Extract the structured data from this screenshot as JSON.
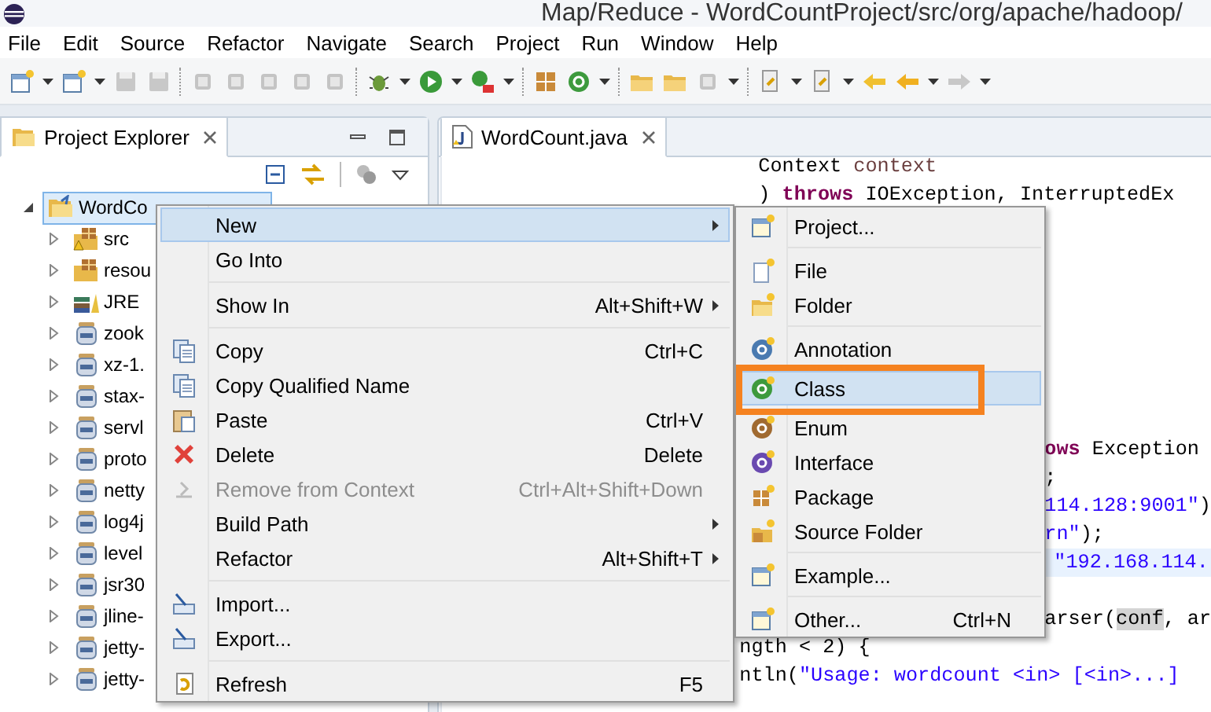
{
  "window": {
    "title": "Map/Reduce - WordCountProject/src/org/apache/hadoop/"
  },
  "menu_bar": [
    "File",
    "Edit",
    "Source",
    "Refactor",
    "Navigate",
    "Search",
    "Project",
    "Run",
    "Window",
    "Help"
  ],
  "project_explorer": {
    "tab": {
      "label": "Project Explorer",
      "selected": true
    },
    "tree": [
      {
        "label": "WordCo",
        "expanded": true,
        "selected": true,
        "children": [
          {
            "label": "src",
            "expanded": false,
            "selected": false
          },
          {
            "label": "resou",
            "expanded": false,
            "selected": false
          },
          {
            "label": "JRE",
            "expanded": false,
            "selected": false
          },
          {
            "label": "zook",
            "expanded": false,
            "selected": false
          },
          {
            "label": "xz-1.",
            "expanded": false,
            "selected": false
          },
          {
            "label": "stax-",
            "expanded": false,
            "selected": false
          },
          {
            "label": "servl",
            "expanded": false,
            "selected": false
          },
          {
            "label": "proto",
            "expanded": false,
            "selected": false
          },
          {
            "label": "netty",
            "expanded": false,
            "selected": false
          },
          {
            "label": "log4j",
            "expanded": false,
            "selected": false
          },
          {
            "label": "level",
            "expanded": false,
            "selected": false
          },
          {
            "label": "jsr30",
            "expanded": false,
            "selected": false
          },
          {
            "label": "jline-",
            "expanded": false,
            "selected": false
          },
          {
            "label": "jetty-",
            "expanded": false,
            "selected": false
          },
          {
            "label": "jetty-",
            "expanded": false,
            "selected": false
          }
        ]
      }
    ]
  },
  "editor": {
    "tab": {
      "label": "WordCount.java",
      "selected": true
    },
    "lines": [
      {
        "current": false,
        "tokens": [
          {
            "text": "Context ",
            "kind": "plain"
          },
          {
            "text": "context",
            "kind": "variable"
          }
        ]
      },
      {
        "current": false,
        "tokens": [
          {
            "text": ") ",
            "kind": "plain"
          },
          {
            "text": "throws",
            "kind": "keyword"
          },
          {
            "text": " IOException, InterruptedEx",
            "kind": "plain"
          }
        ]
      },
      {
        "current": false,
        "tokens": [
          {
            "text": "ows",
            "kind": "keyword"
          },
          {
            "text": " Exception",
            "kind": "plain"
          }
        ]
      },
      {
        "current": false,
        "tokens": [
          {
            "text": ";",
            "kind": "plain"
          }
        ]
      },
      {
        "current": false,
        "tokens": [
          {
            "text": "114.128:9001\"",
            "kind": "string"
          },
          {
            "text": ")",
            "kind": "plain"
          }
        ]
      },
      {
        "current": false,
        "tokens": [
          {
            "text": "rn\"",
            "kind": "string"
          },
          {
            "text": ");",
            "kind": "plain"
          }
        ]
      },
      {
        "current": true,
        "tokens": [
          {
            "text": "\"192.168.114.",
            "kind": "string"
          }
        ]
      },
      {
        "current": false,
        "tokens": [
          {
            "text": "arser(",
            "kind": "plain"
          },
          {
            "text": "conf",
            "kind": "occurrence"
          },
          {
            "text": ", ar",
            "kind": "plain"
          }
        ]
      },
      {
        "current": false,
        "tokens": [
          {
            "text": "ngth < 2) {",
            "kind": "plain"
          }
        ]
      },
      {
        "current": false,
        "tokens": [
          {
            "text": "ntln(",
            "kind": "plain"
          },
          {
            "text": "\"Usage: wordcount <in> [<in>...]",
            "kind": "string"
          }
        ]
      }
    ]
  },
  "context_menu": {
    "groups": [
      [
        {
          "label": "New",
          "selected": true,
          "disabled": false,
          "submenu": true
        },
        {
          "label": "Go Into",
          "selected": false,
          "disabled": false,
          "submenu": false
        }
      ],
      [
        {
          "label": "Show In",
          "shortcut": "Alt+Shift+W",
          "selected": false,
          "disabled": false,
          "submenu": true
        }
      ],
      [
        {
          "label": "Copy",
          "shortcut": "Ctrl+C",
          "selected": false,
          "disabled": false,
          "submenu": false
        },
        {
          "label": "Copy Qualified Name",
          "selected": false,
          "disabled": false,
          "submenu": false
        },
        {
          "label": "Paste",
          "shortcut": "Ctrl+V",
          "selected": false,
          "disabled": false,
          "submenu": false
        },
        {
          "label": "Delete",
          "shortcut": "Delete",
          "selected": false,
          "disabled": false,
          "submenu": false
        },
        {
          "label": "Remove from Context",
          "shortcut": "Ctrl+Alt+Shift+Down",
          "selected": false,
          "disabled": true,
          "submenu": false
        },
        {
          "label": "Build Path",
          "selected": false,
          "disabled": false,
          "submenu": true
        },
        {
          "label": "Refactor",
          "shortcut": "Alt+Shift+T",
          "selected": false,
          "disabled": false,
          "submenu": true
        }
      ],
      [
        {
          "label": "Import...",
          "selected": false,
          "disabled": false,
          "submenu": false
        },
        {
          "label": "Export...",
          "selected": false,
          "disabled": false,
          "submenu": false
        }
      ],
      [
        {
          "label": "Refresh",
          "shortcut": "F5",
          "selected": false,
          "disabled": false,
          "submenu": false
        }
      ]
    ]
  },
  "new_submenu": {
    "groups": [
      [
        {
          "label": "Project...",
          "selected": false,
          "framed": false
        }
      ],
      [
        {
          "label": "File",
          "selected": false,
          "framed": false
        },
        {
          "label": "Folder",
          "selected": false,
          "framed": false
        }
      ],
      [
        {
          "label": "Annotation",
          "selected": false,
          "framed": false
        },
        {
          "label": "Class",
          "selected": true,
          "framed": true
        },
        {
          "label": "Enum",
          "selected": false,
          "framed": false
        },
        {
          "label": "Interface",
          "selected": false,
          "framed": false
        },
        {
          "label": "Package",
          "selected": false,
          "framed": false
        },
        {
          "label": "Source Folder",
          "selected": false,
          "framed": false
        }
      ],
      [
        {
          "label": "Example...",
          "selected": false,
          "framed": false
        }
      ],
      [
        {
          "label": "Other...",
          "shortcut": "Ctrl+N",
          "selected": false,
          "framed": false
        }
      ]
    ]
  }
}
